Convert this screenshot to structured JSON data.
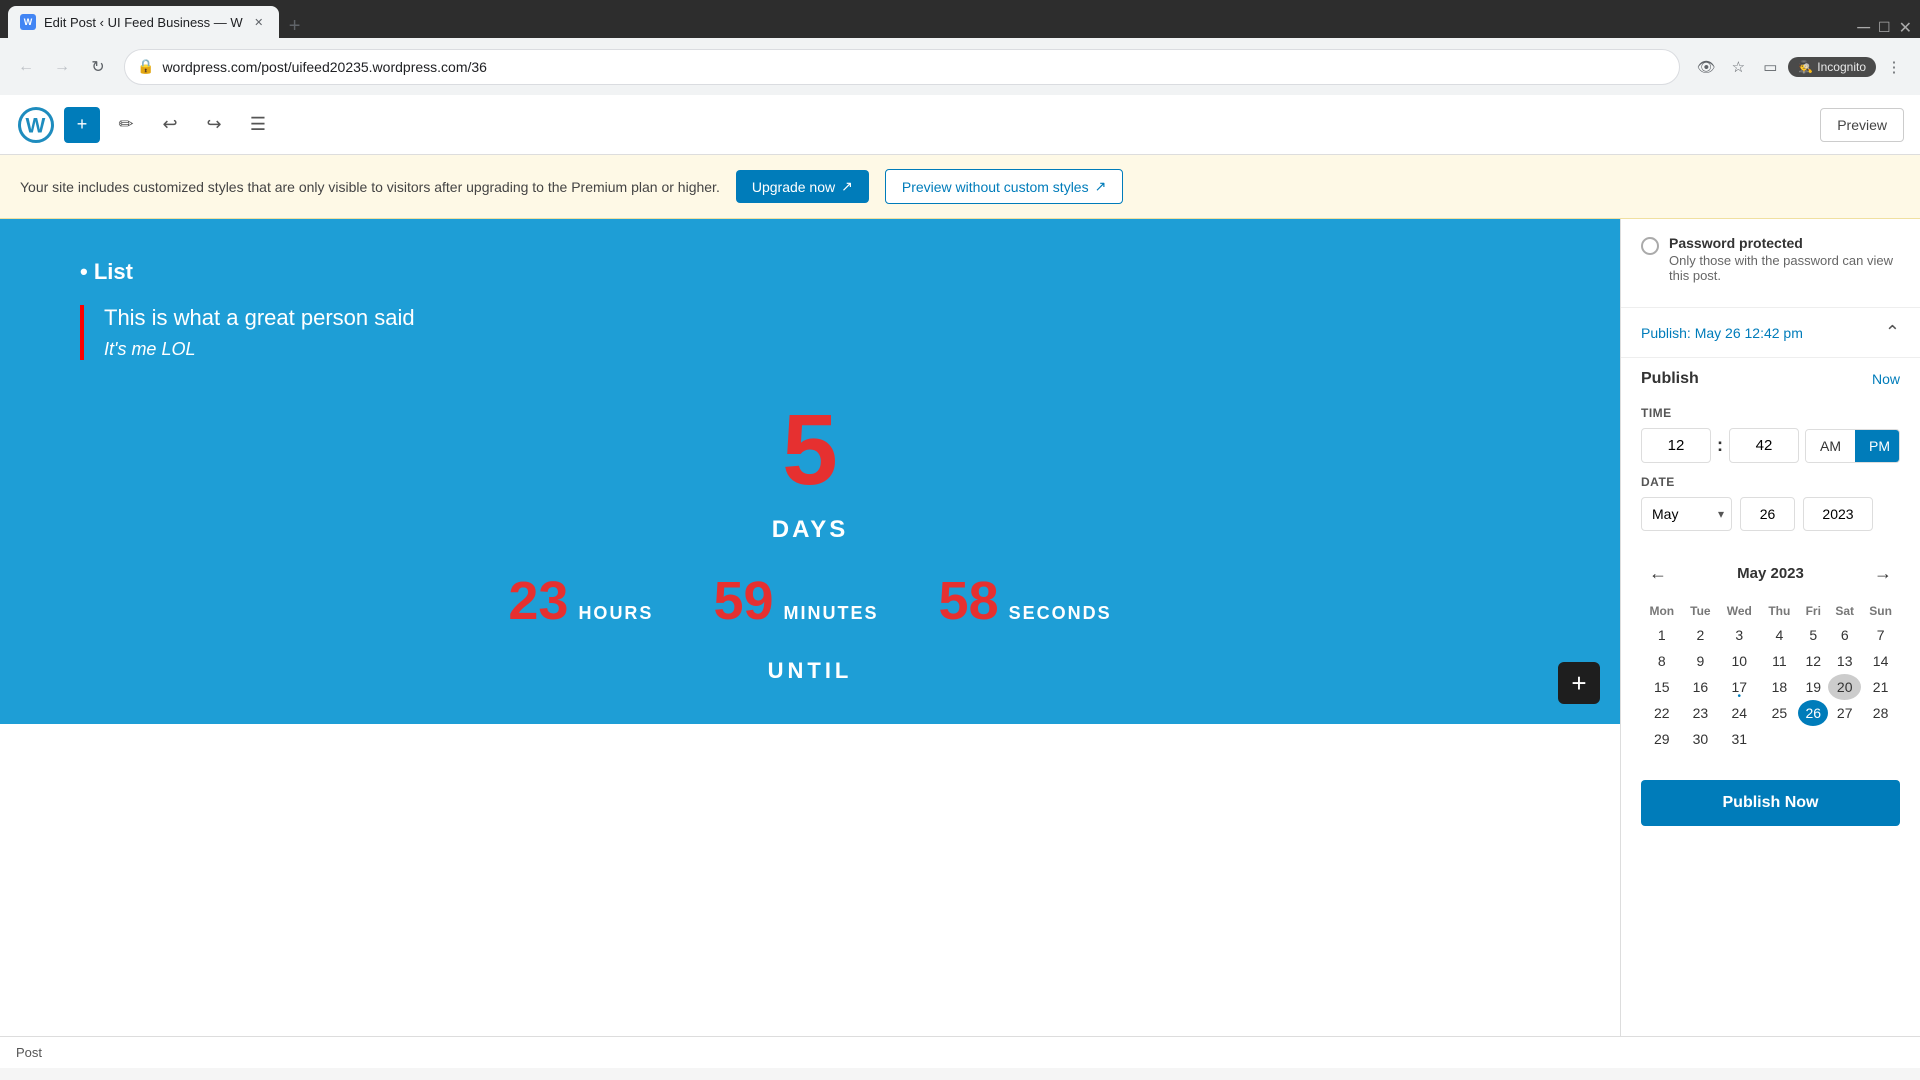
{
  "browser": {
    "tab_title": "Edit Post ‹ UI Feed Business — W",
    "tab_favicon": "W",
    "address": "wordpress.com/post/uifeed20235.wordpress.com/36",
    "incognito_label": "Incognito"
  },
  "toolbar": {
    "preview_label": "Preview"
  },
  "notification": {
    "message": "Your site includes customized styles that are only visible to visitors after upgrading to the Premium plan or higher.",
    "upgrade_label": "Upgrade now",
    "preview_label": "Preview without custom styles"
  },
  "content": {
    "list_header": "• List",
    "quote_text": "This is what a great person said",
    "quote_author": "It's me LOL",
    "countdown_number": "5",
    "countdown_days": "DAYS",
    "hours_num": "23",
    "hours_label": "HOURS",
    "minutes_num": "59",
    "minutes_label": "MINUTES",
    "seconds_num": "58",
    "seconds_label": "SECONDS",
    "until_label": "UNTIL"
  },
  "sidebar": {
    "password_protected_label": "Password protected",
    "password_protected_desc": "Only those with the password can view this post.",
    "publish_header": "Publish:",
    "publish_date_display": "May 26 12:42 pm",
    "publish_label": "Publish",
    "now_link": "Now",
    "time_label": "TIME",
    "hours_value": "12",
    "minutes_value": "42",
    "am_label": "AM",
    "pm_label": "PM",
    "date_label": "DATE",
    "month_value": "May",
    "day_value": "26",
    "year_value": "2023",
    "calendar_month_year": "May 2023",
    "days_of_week": [
      "Mon",
      "Tue",
      "Wed",
      "Thu",
      "Fri",
      "Sat",
      "Sun"
    ],
    "calendar_weeks": [
      [
        null,
        null,
        null,
        null,
        "5",
        "6",
        "7"
      ],
      [
        "8",
        "9",
        "10",
        "11",
        "12",
        "13",
        "14"
      ],
      [
        "15",
        "16",
        "17",
        "18",
        "19",
        "20",
        "21"
      ],
      [
        "22",
        "23",
        "24",
        "25",
        "26",
        "27",
        "28"
      ],
      [
        "29",
        "30",
        "31",
        null,
        null,
        null,
        null
      ]
    ],
    "week1": [
      null,
      null,
      "1",
      "2",
      "3",
      "4",
      "5"
    ],
    "has_dot_date": "17",
    "today_date": "26",
    "grayed_date": "20",
    "publish_now_label": "Publish Now"
  },
  "bottom_bar": {
    "label": "Post"
  }
}
